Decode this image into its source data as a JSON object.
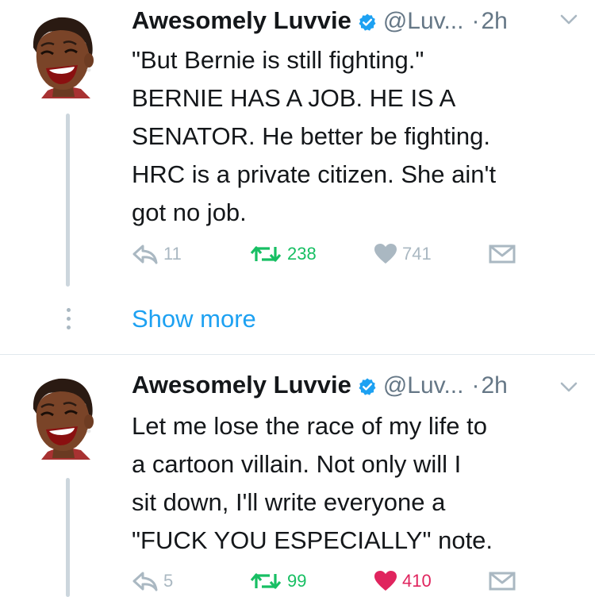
{
  "tweets": [
    {
      "name": "Awesomely Luvvie",
      "handle": "@Luv...",
      "separator": "·",
      "time": "2h",
      "text": "\"But Bernie is still fighting.\"\nBERNIE HAS A JOB. HE IS A\nSENATOR. He better be fighting.\nHRC is a private citizen. She ain't\ngot no job.",
      "replies": "11",
      "retweets": "238",
      "likes": "741",
      "liked": false
    },
    {
      "name": "Awesomely Luvvie",
      "handle": "@Luv...",
      "separator": "·",
      "time": "2h",
      "text": "Let me lose the race of my life to\na cartoon villain. Not only will I\nsit down, I'll write everyone a\n\"FUCK YOU ESPECIALLY\" note.",
      "replies": "5",
      "retweets": "99",
      "likes": "410",
      "liked": true
    }
  ],
  "show_more_label": "Show more",
  "icons": {
    "avatar": "avatar-illustration",
    "verified": "verified-badge-icon",
    "caret": "chevron-down-icon",
    "reply": "reply-icon",
    "retweet": "retweet-icon",
    "like": "heart-icon",
    "dm": "envelope-icon"
  },
  "colors": {
    "accent": "#1da1f2",
    "retweet_green": "#17bf63",
    "like_red": "#e0245e",
    "muted": "#aab8c2",
    "secondary_text": "#657786"
  }
}
